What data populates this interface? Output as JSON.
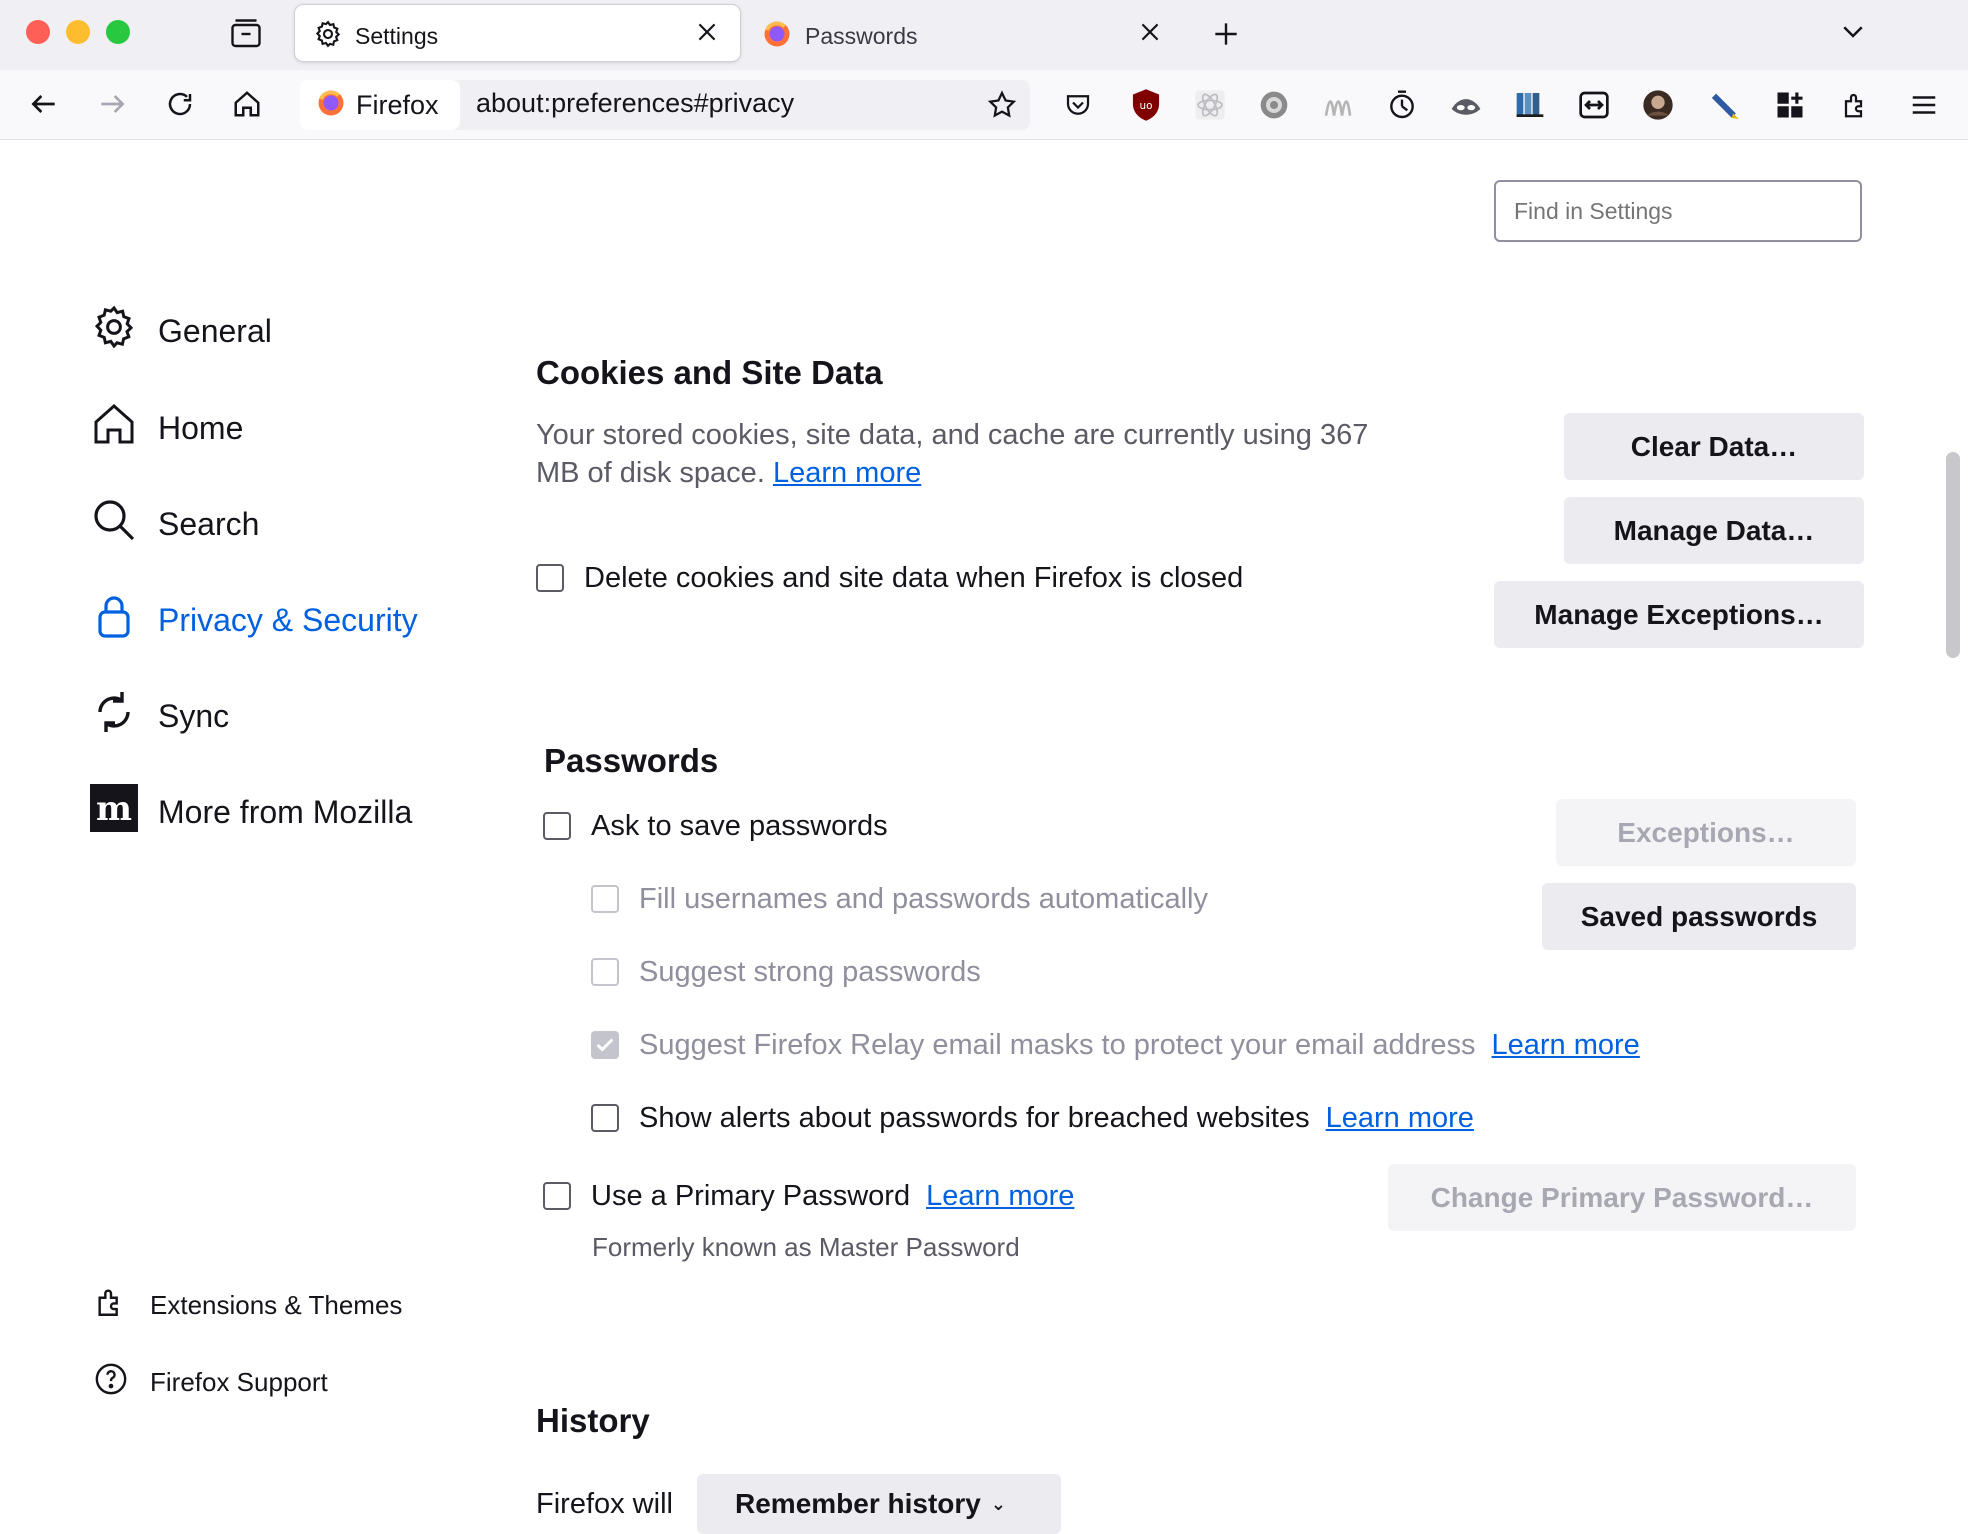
{
  "browser": {
    "tabs": [
      {
        "label": "Settings",
        "active": true
      },
      {
        "label": "Passwords",
        "active": false
      }
    ],
    "identity_label": "Firefox",
    "url": "about:preferences#privacy"
  },
  "search": {
    "placeholder": "Find in Settings"
  },
  "sidebar": {
    "categories": [
      {
        "label": "General",
        "icon": "gear-icon"
      },
      {
        "label": "Home",
        "icon": "home-icon"
      },
      {
        "label": "Search",
        "icon": "search-icon"
      },
      {
        "label": "Privacy & Security",
        "icon": "lock-icon",
        "selected": true
      },
      {
        "label": "Sync",
        "icon": "sync-icon"
      },
      {
        "label": "More from Mozilla",
        "icon": "mozilla-icon"
      }
    ],
    "footer": [
      {
        "label": "Extensions & Themes",
        "icon": "puzzle-icon"
      },
      {
        "label": "Firefox Support",
        "icon": "help-icon"
      }
    ]
  },
  "cookies": {
    "title": "Cookies and Site Data",
    "description_line1": "Your stored cookies, site data, and cache are currently using 367",
    "description_line2": "MB of disk space.",
    "learn_more": "Learn more",
    "delete_on_close": "Delete cookies and site data when Firefox is closed",
    "clear_data": "Clear Data…",
    "manage_data": "Manage Data…",
    "manage_exceptions": "Manage Exceptions…"
  },
  "passwords": {
    "title": "Passwords",
    "ask_to_save": "Ask to save passwords",
    "fill_auto": "Fill usernames and passwords automatically",
    "suggest_strong": "Suggest strong passwords",
    "suggest_relay": "Suggest Firefox Relay email masks to protect your email address",
    "relay_learn_more": "Learn more",
    "breach_alerts": "Show alerts about passwords for breached websites",
    "breach_learn_more": "Learn more",
    "primary_password": "Use a Primary Password",
    "primary_learn_more": "Learn more",
    "formerly": "Formerly known as Master Password",
    "exceptions": "Exceptions…",
    "saved_passwords": "Saved passwords",
    "change_primary": "Change Primary Password…"
  },
  "history": {
    "title": "History",
    "firefox_will": "Firefox will",
    "mode": "Remember history"
  },
  "colors": {
    "accent": "#0061e0",
    "close": "#ff5f57",
    "minimize": "#febc2e",
    "zoom": "#28c840"
  }
}
